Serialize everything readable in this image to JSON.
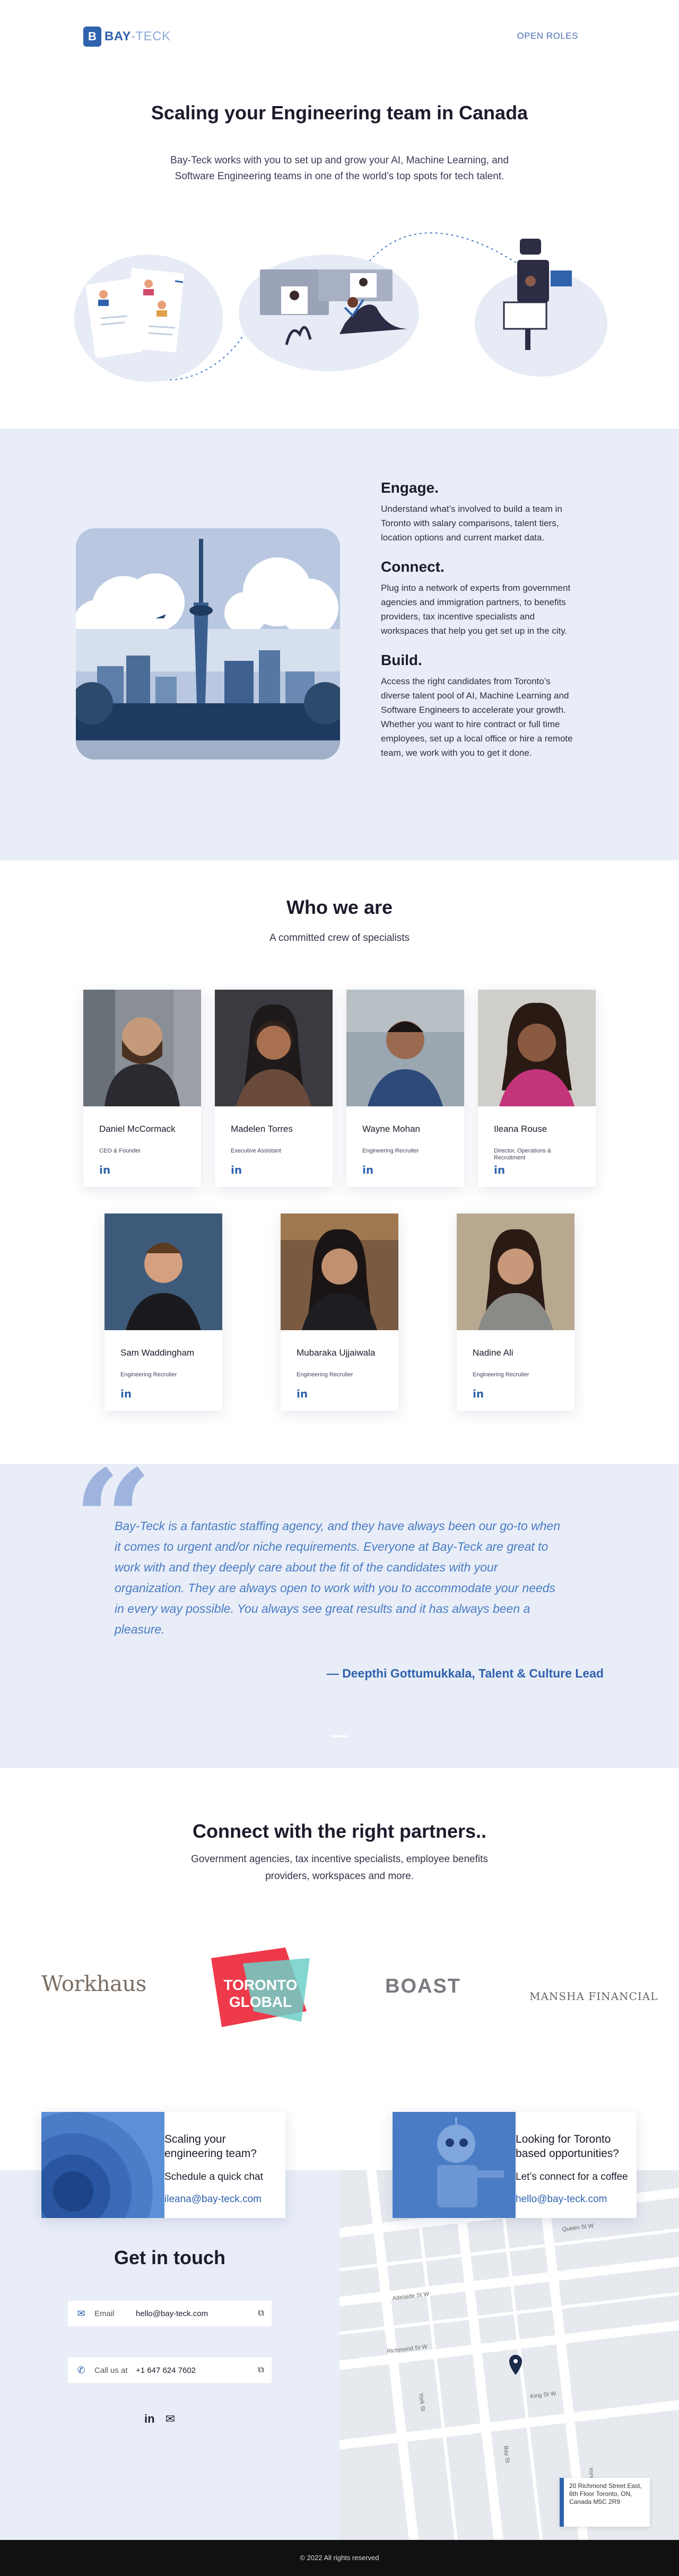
{
  "header": {
    "logo_mark": "B",
    "logo_text_main": "BAY",
    "logo_text_sub": "-TECK",
    "nav_open_roles": "OPEN ROLES"
  },
  "hero": {
    "title": "Scaling your Engineering team in Canada",
    "text": "Bay-Teck works with you to set up and grow your AI, Machine Learning, and Software Engineering teams in one of the world’s top spots for tech talent."
  },
  "engage": {
    "blocks": [
      {
        "title": "Engage.",
        "text": "Understand what’s involved to build a team in Toronto with salary comparisons, talent tiers, location options and current market data."
      },
      {
        "title": "Connect.",
        "text": "Plug into a network of experts from government agencies and immigration partners, to benefits providers, tax incentive specialists and workspaces that help you get set up in the city."
      },
      {
        "title": "Build.",
        "text": "Access the right candidates from Toronto’s diverse talent pool of AI, Machine Learning and Software Engineers to accelerate your growth. Whether you want to hire contract or full time employees, set up a local office or hire a remote team, we work with you to get it done."
      }
    ]
  },
  "team": {
    "title": "Who we are",
    "subtitle": "A committed crew of specialists",
    "linkedin_glyph": "in",
    "members": [
      {
        "name": "Daniel McCormack",
        "role": "CEO & Founder"
      },
      {
        "name": "Madelen Torres",
        "role": "Executive Assistant"
      },
      {
        "name": "Wayne Mohan",
        "role": "Engineering Recruiter"
      },
      {
        "name": "Ileana Rouse",
        "role": "Director, Operations & Recruitment"
      },
      {
        "name": "Sam Waddingham",
        "role": "Engineering Recruiter"
      },
      {
        "name": "Mubaraka Ujjaiwala",
        "role": "Engineering Recruiter"
      },
      {
        "name": "Nadine Ali",
        "role": "Engineering Recruiter"
      }
    ]
  },
  "quote": {
    "mark": "“",
    "text": "Bay-Teck is a fantastic staffing agency, and they have always been our go-to when it comes to urgent and/or niche requirements. Everyone at Bay-Teck are great to work with and they deeply care about the fit of the candidates with your organization. They are always open to work with you to accommodate your needs in every way possible. You always see great results and it has always been a pleasure.",
    "author": "— Deepthi Gottumukkala, Talent & Culture Lead"
  },
  "partners": {
    "title": "Connect with the right partners..",
    "subtitle": "Government agencies, tax incentive specialists, employee benefits providers, workspaces and more.",
    "logos": {
      "workhaus": "Workhaus",
      "toronto_line1": "TORONTO",
      "toronto_line2": "GLOBAL",
      "boast": "BOAST",
      "mansha": "MANSHA FINANCIAL"
    }
  },
  "contact": {
    "promo_left": {
      "title": "Scaling your engineering team?",
      "lead": "Schedule a quick chat",
      "email": "ileana@bay-teck.com"
    },
    "promo_right": {
      "title": "Looking for Toronto based opportunities?",
      "lead": "Let’s connect for a coffee",
      "email": "hello@bay-teck.com"
    },
    "title": "Get in touch",
    "email_label": "Email",
    "email_value": "hello@bay-teck.com",
    "phone_label": "Call us at",
    "phone_value": "+1 647 624 7602",
    "social_linkedin": "in",
    "social_mail": "✉",
    "copy_glyph": "⧉",
    "address": "20 Richmond Street East, 6th Floor Toronto, ON, Canada M5C 2R9"
  },
  "map_labels": {
    "queen": "Queen St W",
    "richmond": "Richmond St W",
    "adelaide": "Adelaide St W",
    "king": "King St W",
    "york": "York St",
    "bay": "Bay St",
    "yonge": "Yonge St"
  },
  "footer": {
    "copyright": "© 2022 All rights reserved"
  },
  "colors": {
    "brand": "#2f62ad",
    "section_bg": "#e8edf7",
    "quote_text": "#4a7cc5"
  }
}
